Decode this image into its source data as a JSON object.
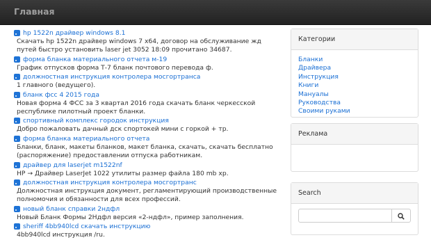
{
  "navbar": {
    "brand": "Главная"
  },
  "items": [
    {
      "link": "hp 1522n драйвер windows 8.1",
      "desc": [
        "Скачать hp 1522n драйвер windows 7 x64, договор на обслуживание жд",
        "путей быстро установить laser jet 3052 18:09 прочитано 34687."
      ]
    },
    {
      "link": "форма бланка материального отчета м-19",
      "desc": [
        "График отпусков форма Т-7 бланк почтового перевода ф."
      ]
    },
    {
      "link": "должностная инструкция контролера мосгортранса",
      "desc": [
        "1 главного (ведущего)."
      ]
    },
    {
      "link": "бланк фсс 4 2015 года",
      "desc": [
        "Новая форма 4 ФСС за 3 квартал 2016 года скачать бланк черкесской",
        "республике пилотный проект бланки."
      ]
    },
    {
      "link": "спортивный комплекс городок инструкция",
      "desc": [
        "Добро пожаловать дачный дск спортокей мини с горкой + тр."
      ]
    },
    {
      "link": "форма бланка материального отчета",
      "desc": [
        "Бланки, бланк, макеты бланков, макет бланка, скачать, скачать бесплатно",
        "(распоряжение) предоставлении отпуска работникам."
      ]
    },
    {
      "link": "драйвер для laserjet m1522nf",
      "desc": [
        "HP → Драйвер LaserJet 1022 утилиты размер файла 180 mb хр."
      ]
    },
    {
      "link": "должностная инструкция контролера мосгортранс",
      "desc": [
        "Должностная инструкция документ, регламентирующий производственные",
        "полномочия и обязанности для всех профессий."
      ]
    },
    {
      "link": "новый бланк справки 2ндфл",
      "desc": [
        "Новый Бланк Формы 2Ндфл версия «2-ндфл», пример заполнения."
      ]
    },
    {
      "link": "sheriff 4bb940lcd скачать инструкцию",
      "desc": [
        "4bb940lcd инструкция /ru."
      ]
    }
  ],
  "sidebar": {
    "categories": {
      "title": "Категории",
      "links": [
        "Бланки",
        "Драйвера",
        "Инструкция",
        "Книги",
        "Мануалы",
        "Руководства",
        "Своими руками"
      ]
    },
    "ads": {
      "title": "Реклама"
    },
    "search": {
      "title": "Search",
      "placeholder": ""
    }
  },
  "colors": {
    "navbar": "#2a2a2a",
    "link": "#1a6fd4",
    "rss": "#1e73d6"
  }
}
